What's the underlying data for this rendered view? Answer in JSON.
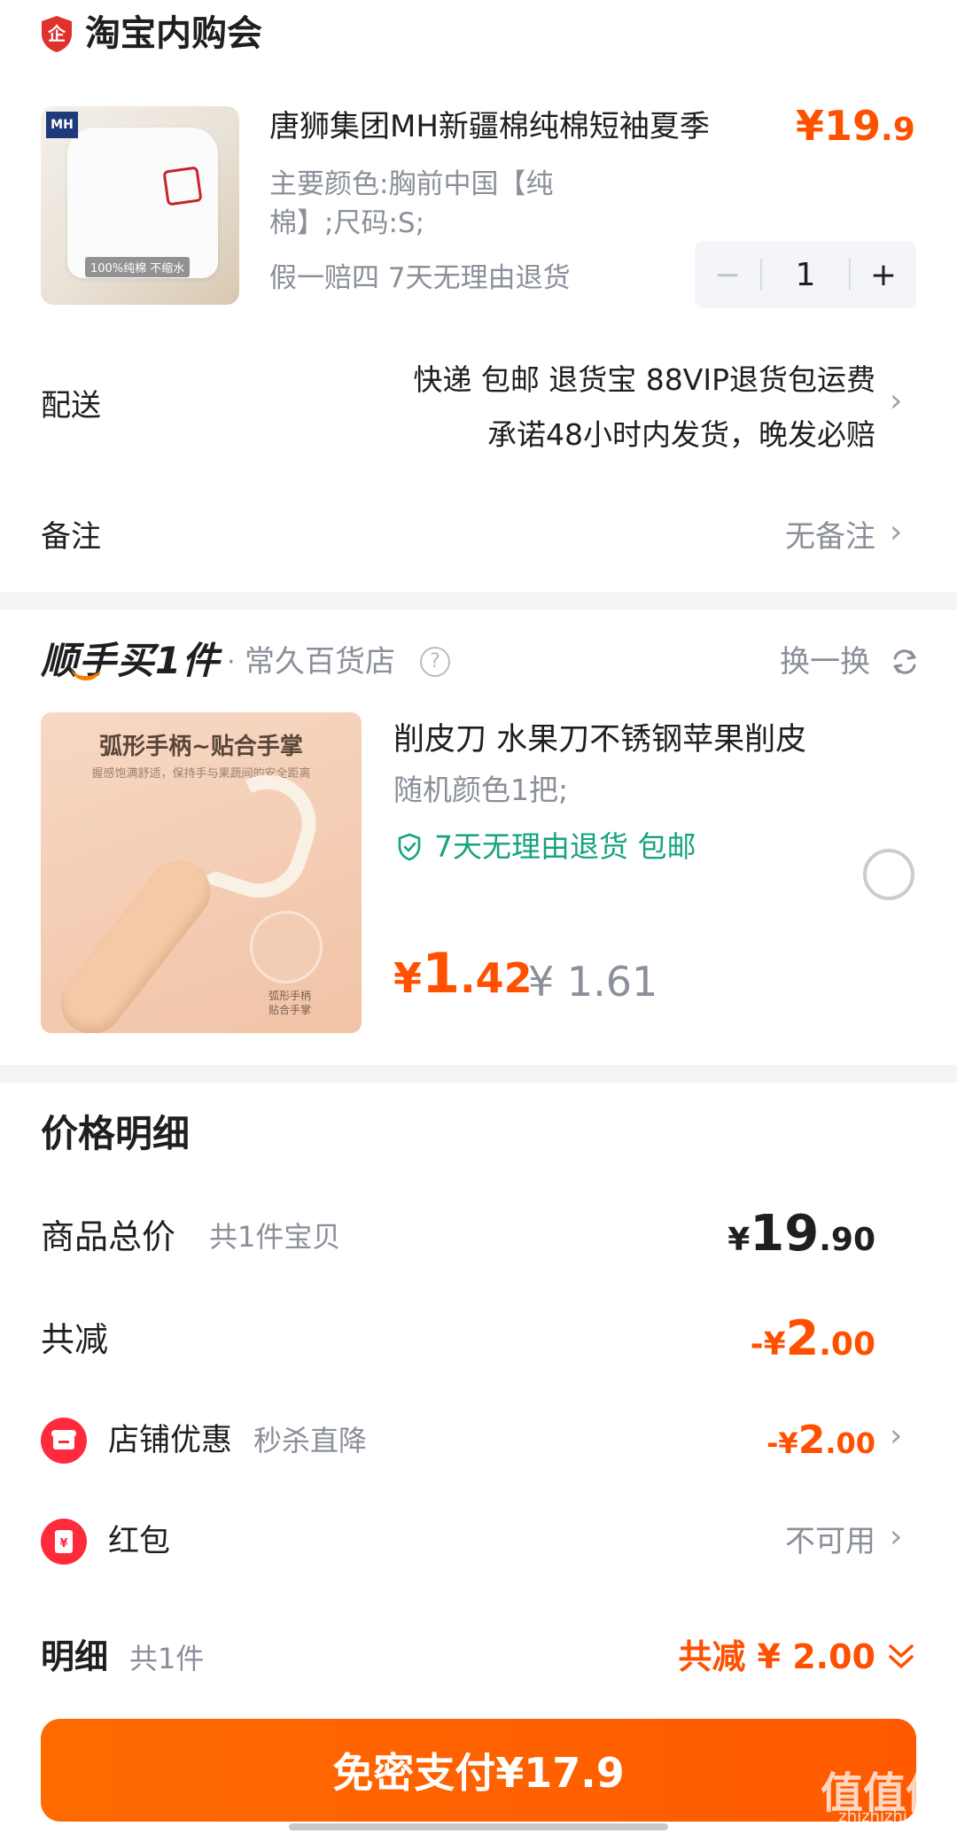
{
  "store": {
    "name": "淘宝内购会",
    "logo_icon": "shield-logo-icon"
  },
  "product": {
    "title": "唐狮集团MH新疆棉纯棉短袖夏季",
    "price_symbol": "¥",
    "price_int": "19",
    "price_dec": ".9",
    "sku_line1": "主要颜色:胸前中国【纯",
    "sku_line2": "棉】;尺码:S;",
    "services": "假一赔四  7天无理由退货",
    "quantity": "1",
    "image_brand": "MH",
    "image_tag": "100%纯棉 不缩水"
  },
  "delivery": {
    "label": "配送",
    "line1": "快递 包邮 退货宝 88VIP退货包运费",
    "line2": "承诺48小时内发货，晚发必赔"
  },
  "remark": {
    "label": "备注",
    "value": "无备注"
  },
  "addon": {
    "title": "顺手买1件",
    "dot": "·",
    "store": "常久百货店",
    "help": "?",
    "swap": "换一换",
    "item": {
      "image_caption": "弧形手柄~贴合手掌",
      "image_sub": "握感饱满舒适，保持手与果蔬间的安全距离",
      "image_circle_label": "弧形手柄\n贴合手掌",
      "title": "削皮刀 水果刀不锈钢苹果削皮",
      "sku": "随机颜色1把;",
      "service": "7天无理由退货  包邮",
      "price_symbol": "¥",
      "price_int": "1",
      "price_dec": ".42",
      "orig_price": "¥ 1.61"
    }
  },
  "price_detail": {
    "title": "价格明细",
    "total_label": "商品总价",
    "total_sub": "共1件宝贝",
    "total_symbol": "¥",
    "total_int": "19",
    "total_dec": ".90",
    "discount_label": "共减",
    "discount_prefix": "-¥",
    "discount_int": "2",
    "discount_dec": ".00",
    "shop_label": "店铺优惠",
    "shop_sub": "秒杀直降",
    "shop_prefix": "-¥",
    "shop_int": "2",
    "shop_dec": ".00",
    "redpack_label": "红包",
    "redpack_value": "不可用"
  },
  "summary": {
    "label": "明细",
    "sub": "共1件",
    "value": "共减 ¥ 2.00"
  },
  "pay_button": {
    "label": "免密支付¥17.9"
  },
  "watermark": {
    "text": "值值值",
    "sub": "zhizhizhi.com"
  },
  "colors": {
    "accent": "#ff5000",
    "green": "#16a37f",
    "gray_text": "#8a8f99",
    "divider": "#f3f4f6"
  }
}
